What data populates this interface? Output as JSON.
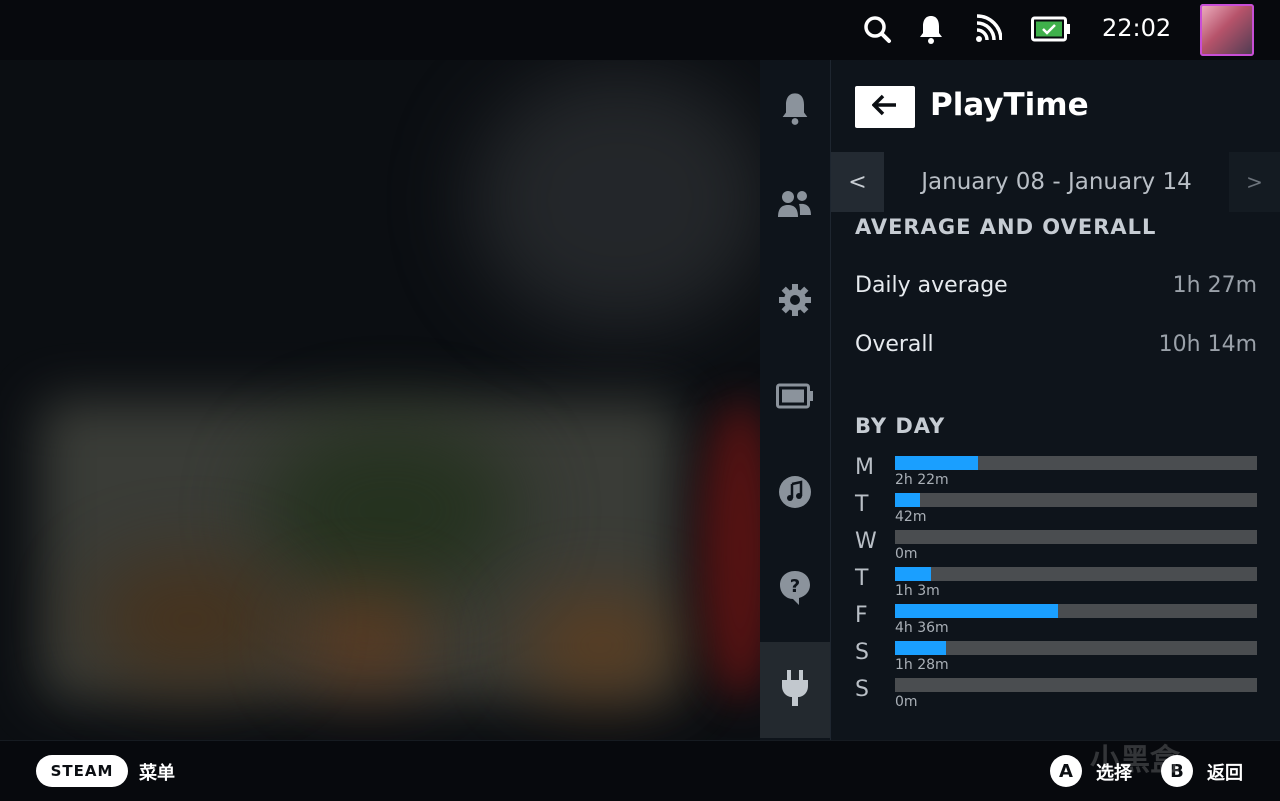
{
  "status": {
    "time": "22:02",
    "icons": [
      "search-icon",
      "bell-icon",
      "wifi-icon",
      "battery-charging-icon"
    ]
  },
  "rail": {
    "items": [
      {
        "name": "notifications",
        "icon": "bell-icon"
      },
      {
        "name": "friends",
        "icon": "friends-icon"
      },
      {
        "name": "settings",
        "icon": "gear-icon"
      },
      {
        "name": "performance",
        "icon": "battery-icon"
      },
      {
        "name": "music",
        "icon": "music-note-icon"
      },
      {
        "name": "help",
        "icon": "help-icon"
      },
      {
        "name": "plugins",
        "icon": "plug-icon",
        "active": true
      }
    ]
  },
  "panel": {
    "title": "PlayTime",
    "date_range": "January 08 - January 14",
    "prev_label": "<",
    "next_label": ">",
    "average_section": "AVERAGE AND OVERALL",
    "daily_average_label": "Daily average",
    "daily_average_value": "1h 27m",
    "overall_label": "Overall",
    "overall_value": "10h 14m",
    "by_day_section": "BY DAY",
    "days": [
      {
        "letter": "M",
        "label": "2h 22m",
        "fraction": 0.23
      },
      {
        "letter": "T",
        "label": "42m",
        "fraction": 0.07
      },
      {
        "letter": "W",
        "label": "0m",
        "fraction": 0
      },
      {
        "letter": "T",
        "label": "1h 3m",
        "fraction": 0.1
      },
      {
        "letter": "F",
        "label": "4h 36m",
        "fraction": 0.45
      },
      {
        "letter": "S",
        "label": "1h 28m",
        "fraction": 0.14
      },
      {
        "letter": "S",
        "label": "0m",
        "fraction": 0
      }
    ]
  },
  "bottom": {
    "steam_label": "STEAM",
    "menu_label": "菜单",
    "a_key": "A",
    "a_label": "选择",
    "b_key": "B",
    "b_label": "返回",
    "watermark": "小黑盒"
  },
  "colors": {
    "accent": "#1a9fff",
    "track": "#4a4d50",
    "panel": "#0e141b"
  }
}
